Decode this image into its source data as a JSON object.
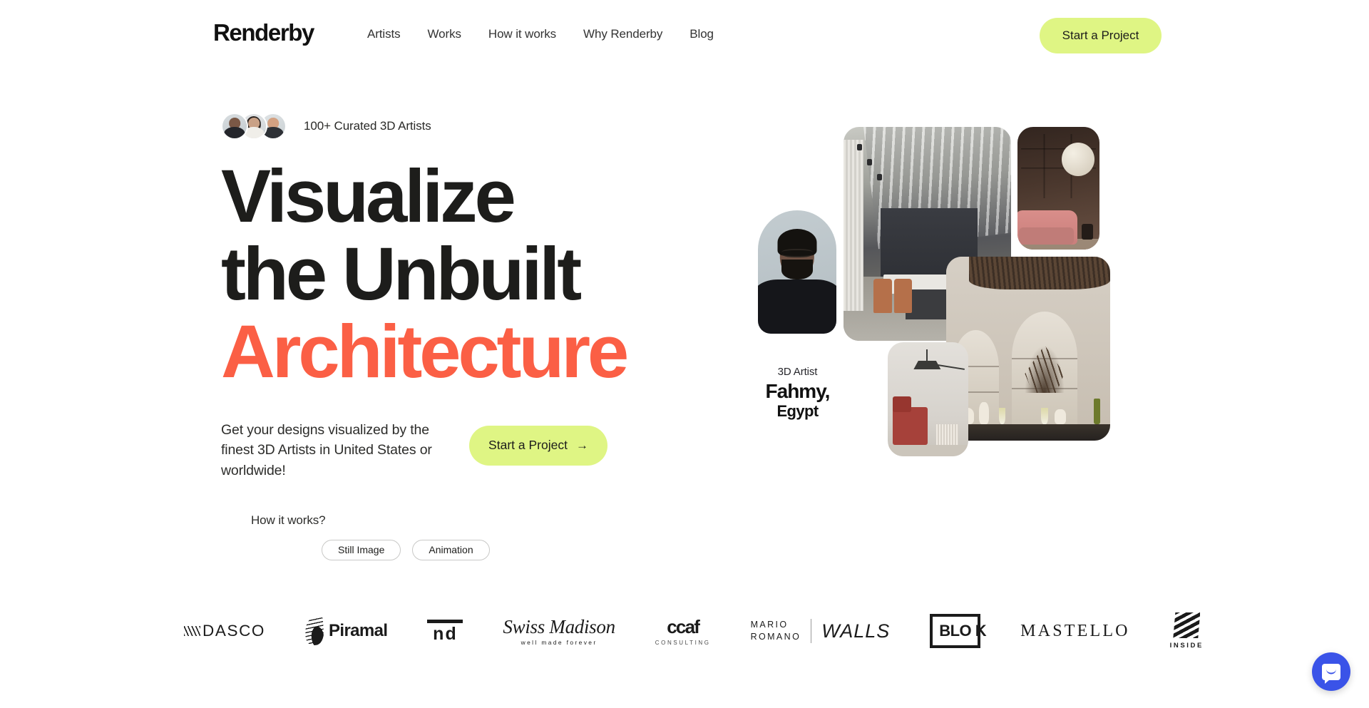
{
  "brand": {
    "name": "Renderby"
  },
  "nav": {
    "items": [
      {
        "label": "Artists"
      },
      {
        "label": "Works"
      },
      {
        "label": "How it works"
      },
      {
        "label": "Why Renderby"
      },
      {
        "label": "Blog"
      }
    ],
    "cta_label": "Start a Project"
  },
  "hero": {
    "badge_text": "100+ Curated 3D Artists",
    "headline_line1": "Visualize",
    "headline_line2": "the Unbuilt",
    "headline_line3": "Architecture",
    "subcopy": "Get your designs visualized by the finest 3D Artists in United States or worldwide!",
    "cta_label": "Start a Project",
    "cta_arrow": "→",
    "how_label": "How it works?",
    "toggles": [
      {
        "label": "Still Image"
      },
      {
        "label": "Animation"
      }
    ]
  },
  "artist": {
    "role": "3D Artist",
    "name": "Fahmy,",
    "country": "Egypt"
  },
  "logos": [
    {
      "name": "DASCO",
      "text": "DASCO"
    },
    {
      "name": "Piramal",
      "text": "Piramal"
    },
    {
      "name": "nd",
      "text": "nd"
    },
    {
      "name": "Swiss Madison",
      "text": "Swiss Madison",
      "tagline": "well made forever"
    },
    {
      "name": "CCAF Consulting",
      "text": "ccaf",
      "tagline": "CONSULTING"
    },
    {
      "name": "Mario Romano Walls",
      "text": "MARIO\nROMANO",
      "text2": "WALLS"
    },
    {
      "name": "BLOK",
      "text": "BLO",
      "text2": "K"
    },
    {
      "name": "Mastello",
      "text": "MASTELLO"
    },
    {
      "name": "Inside",
      "text": "INSIDE"
    }
  ],
  "colors": {
    "accent_coral": "#fb5f45",
    "accent_lime": "#dff584",
    "text_dark": "#1d1d1b",
    "chat_blue": "#3a53e8"
  }
}
